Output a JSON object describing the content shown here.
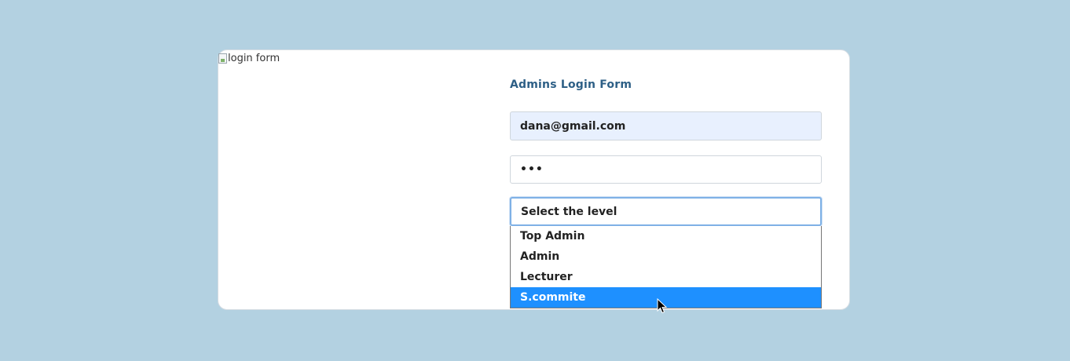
{
  "card": {
    "image_alt": "login form",
    "form": {
      "title": "Admins Login Form",
      "email_value": "dana@gmail.com",
      "password_value": "•••",
      "level_select_label": "Select the level",
      "level_options": [
        "Top Admin",
        "Admin",
        "Lecturer",
        "S.commite"
      ],
      "highlighted_option": "S.commite"
    }
  },
  "colors": {
    "page_background": "#b3d1e1",
    "title": "#2d5f86",
    "email_autofill_bg": "#e8f0fe",
    "highlight": "#1e90ff"
  },
  "icons": {
    "broken_image": "broken-image-icon",
    "cursor": "mouse-pointer-icon"
  }
}
